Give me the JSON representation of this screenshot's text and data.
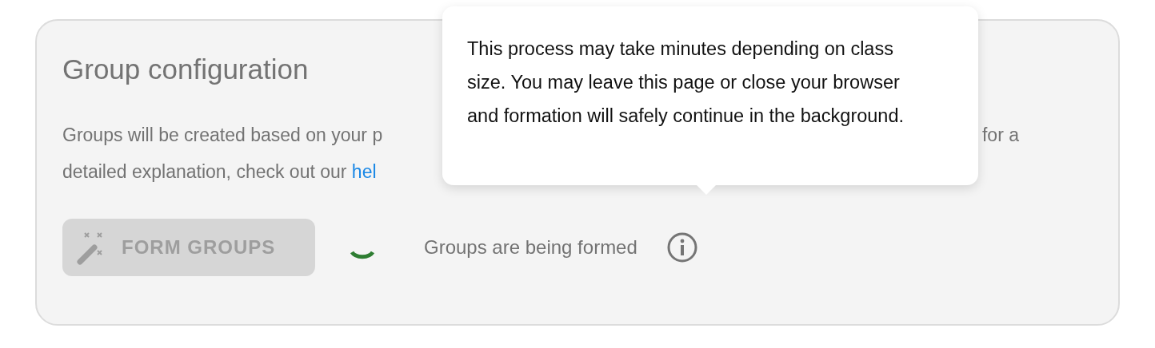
{
  "card": {
    "title": "Group configuration",
    "description": {
      "line_1_start": "Groups will be created based on your p",
      "line_1_end": "for a",
      "line_2": "detailed explanation, check out our",
      "link": "hel"
    },
    "form_button": {
      "label": "FORM GROUPS",
      "disabled": true
    },
    "status": "Groups are being formed"
  },
  "tooltip": {
    "text": "This process may take minutes depending on class size. You may leave this page or close your browser and formation will safely continue in the background."
  }
}
